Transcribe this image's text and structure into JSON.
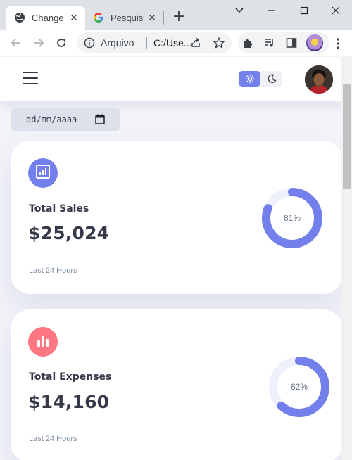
{
  "browser": {
    "tabs": [
      {
        "title": "Change",
        "icon": "globe-icon",
        "active": true,
        "close_label": "✕"
      },
      {
        "title": "Pesquisa",
        "icon": "google-icon",
        "active": false,
        "close_label": "✕"
      }
    ],
    "new_tab_label": "+",
    "address": {
      "scheme_label": "Arquivo",
      "url": "C:/Use..."
    }
  },
  "app": {
    "theme": {
      "active": "light"
    },
    "date_input": {
      "placeholder": "dd/mm/aaaa"
    },
    "cards": [
      {
        "label": "Total Sales",
        "amount": "$25,024",
        "period": "Last 24 Hours",
        "percent_label": "81%",
        "percent": 81,
        "icon": "analytics-icon",
        "icon_color": "#7380ec"
      },
      {
        "label": "Total Expenses",
        "amount": "$14,160",
        "period": "Last 24 Hours",
        "percent_label": "62%",
        "percent": 62,
        "icon": "bar-chart-icon",
        "icon_color": "#ff7782"
      }
    ]
  },
  "colors": {
    "primary": "#7380ec",
    "danger": "#ff7782",
    "dark": "#363949",
    "muted": "#7d8da1"
  }
}
